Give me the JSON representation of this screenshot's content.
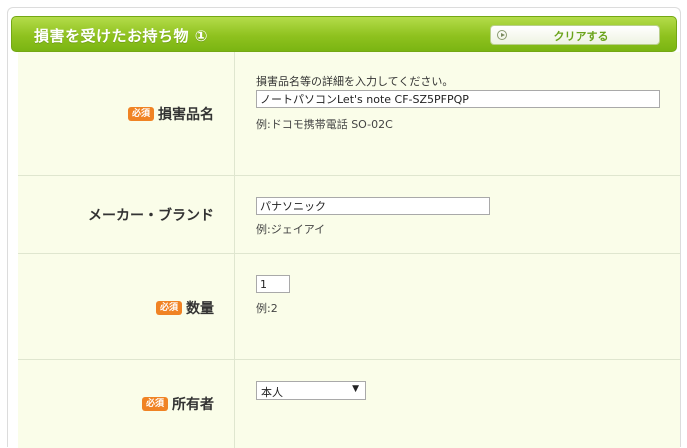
{
  "section": {
    "title": "損害を受けたお持ち物 ①",
    "clear_label": "クリアする"
  },
  "required_badge": "必須",
  "fields": {
    "item_name": {
      "label": "損害品名",
      "required": true,
      "help": "損害品名等の詳細を入力してください。",
      "value": "ノートパソコンLet's note CF-SZ5PFPQP",
      "example": "例:ドコモ携帯電話 SO-02C"
    },
    "maker": {
      "label": "メーカー・ブランド",
      "required": false,
      "value": "パナソニック",
      "example": "例:ジェイアイ"
    },
    "quantity": {
      "label": "数量",
      "required": true,
      "value": "1",
      "example": "例:2"
    },
    "owner": {
      "label": "所有者",
      "required": true,
      "selected": "本人"
    }
  },
  "colors": {
    "header_green": "#8fc21f",
    "row_bg": "#fafde9",
    "badge_orange": "#f08324"
  }
}
